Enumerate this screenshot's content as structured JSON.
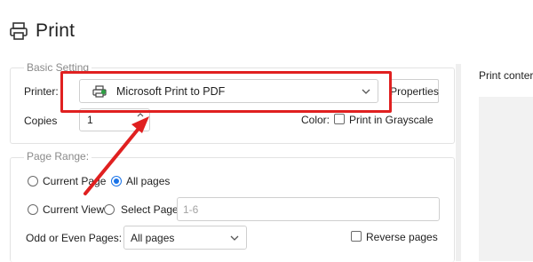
{
  "header": {
    "title": "Print",
    "icon": "printer-icon"
  },
  "basic_setting": {
    "legend": "Basic Setting",
    "printer_label": "Printer:",
    "printer_value": "Microsoft Print to PDF",
    "properties_label": "Properties",
    "copies_label": "Copies",
    "copies_value": "1",
    "color_label": "Color:",
    "grayscale_label": "Print in Grayscale"
  },
  "page_range": {
    "legend": "Page Range:",
    "current_page_label": "Current Page",
    "all_pages_label": "All pages",
    "current_view_label": "Current View",
    "select_page_label": "Select Page:",
    "select_page_placeholder": "1-6",
    "odd_even_label": "Odd or Even Pages:",
    "odd_even_value": "All pages",
    "reverse_pages_label": "Reverse pages"
  },
  "preview": {
    "label": "Print conter"
  },
  "colors": {
    "accent": "#1a73e8",
    "annotation": "#e02020"
  }
}
